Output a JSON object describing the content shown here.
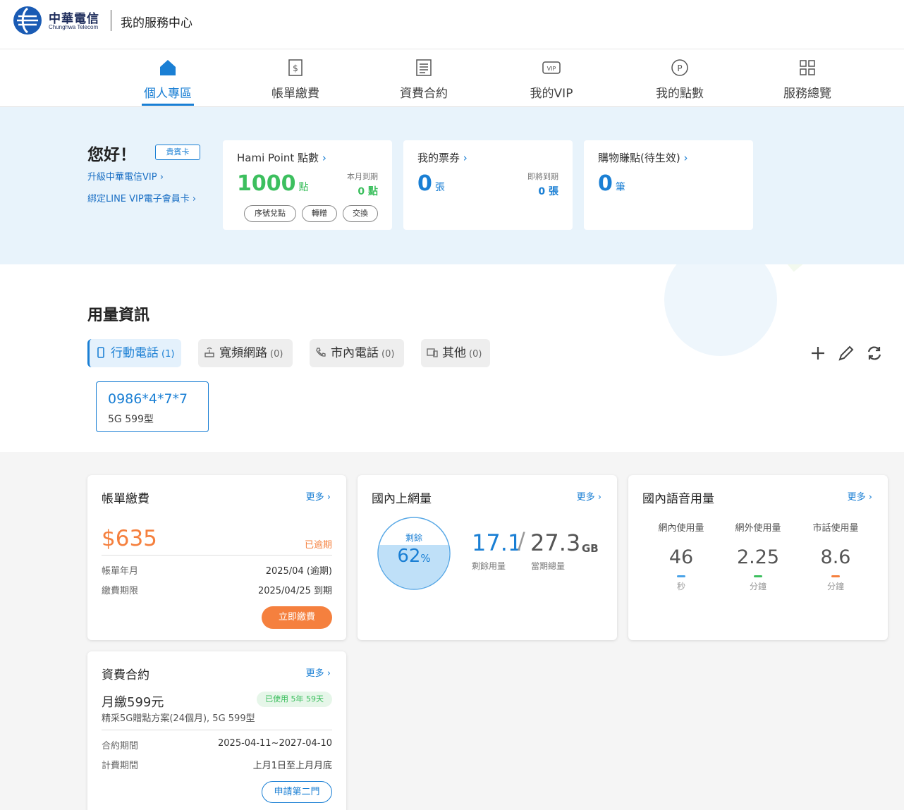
{
  "header": {
    "logo_cn": "中華電信",
    "logo_en": "Chunghwa Telecom",
    "title": "我的服務中心"
  },
  "nav": [
    {
      "label": "個人專區",
      "icon": "home-icon",
      "active": true
    },
    {
      "label": "帳單繳費",
      "icon": "bill-icon",
      "active": false
    },
    {
      "label": "資費合約",
      "icon": "contract-icon",
      "active": false
    },
    {
      "label": "我的VIP",
      "icon": "vip-icon",
      "active": false
    },
    {
      "label": "我的點數",
      "icon": "points-icon",
      "active": false
    },
    {
      "label": "服務總覽",
      "icon": "grid-icon",
      "active": false
    }
  ],
  "hero": {
    "greeting": "您好！",
    "badge": "貴賓卡",
    "link_vip": "升級中華電信VIP",
    "link_line": "綁定LINE VIP電子會員卡",
    "hami": {
      "title": "Hami Point 點數",
      "value": "1000",
      "unit": "點",
      "expire_label": "本月到期",
      "expire_value": "0 點",
      "buttons": [
        "序號兌點",
        "轉贈",
        "交換"
      ]
    },
    "tickets": {
      "title": "我的票券",
      "value": "0",
      "unit": "張",
      "expire_label": "即將到期",
      "expire_value": "0 張"
    },
    "shopping": {
      "title": "購物賺點(待生效)",
      "value": "0",
      "unit": "筆"
    }
  },
  "usage": {
    "title": "用量資訊",
    "tabs": [
      {
        "label": "行動電話",
        "count": "(1)",
        "active": true
      },
      {
        "label": "寬頻網路",
        "count": "(0)",
        "active": false
      },
      {
        "label": "市內電話",
        "count": "(0)",
        "active": false
      },
      {
        "label": "其他",
        "count": "(0)",
        "active": false
      }
    ],
    "phone": {
      "number": "0986*4*7*7",
      "plan": "5G 599型"
    }
  },
  "bill": {
    "title": "帳單繳費",
    "more": "更多",
    "amount": "$635",
    "status": "已逾期",
    "rows": [
      {
        "label": "帳單年月",
        "value": "2025/04 (逾期)"
      },
      {
        "label": "繳費期限",
        "value": "2025/04/25 到期"
      }
    ],
    "pay_button": "立即繳費"
  },
  "data": {
    "title": "國內上網量",
    "more": "更多",
    "remain_label": "剩餘",
    "percent": "62",
    "percent_unit": "%",
    "percent_value": 0.62,
    "used": "17.1",
    "total": "27.3",
    "unit": "GB",
    "used_label": "剩餘用量",
    "total_label": "當期總量"
  },
  "voice": {
    "title": "國內語音用量",
    "more": "更多",
    "items": [
      {
        "label": "網內使用量",
        "value": "46",
        "unit": "秒",
        "color": "#4aa3e8"
      },
      {
        "label": "網外使用量",
        "value": "2.25",
        "unit": "分鐘",
        "color": "#3cbf5e"
      },
      {
        "label": "市話使用量",
        "value": "8.6",
        "unit": "分鐘",
        "color": "#f5803e"
      }
    ]
  },
  "contract": {
    "title": "資費合約",
    "more": "更多",
    "plan": "月繳599元",
    "used_badge": "已使用 5年 59天",
    "desc": "精采5G贈點方案(24個月), 5G 599型",
    "rows": [
      {
        "label": "合約期間",
        "value": "2025-04-11~2027-04-10"
      },
      {
        "label": "計費期間",
        "value": "上月1日至上月月底"
      }
    ],
    "button": "申請第二門"
  },
  "colors": {
    "accent": "#1a7fd4",
    "green": "#3cbf5e",
    "orange": "#f5803e",
    "hero_bg": "#e8f3fb"
  }
}
